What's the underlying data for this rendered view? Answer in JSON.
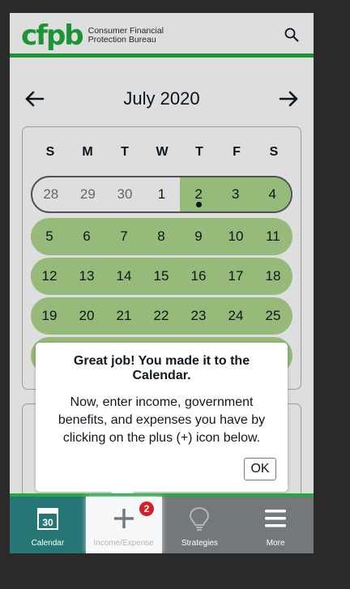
{
  "header": {
    "logo_mark": "cfpb",
    "logo_line1": "Consumer Financial",
    "logo_line2": "Protection Bureau",
    "search_icon": "search-icon"
  },
  "month_nav": {
    "title": "July 2020",
    "prev_icon": "arrow-left-icon",
    "next_icon": "arrow-right-icon"
  },
  "calendar": {
    "weekdays": [
      "S",
      "M",
      "T",
      "W",
      "T",
      "F",
      "S"
    ],
    "weeks": [
      [
        "28",
        "29",
        "30",
        "1",
        "2",
        "3",
        "4"
      ],
      [
        "5",
        "6",
        "7",
        "8",
        "9",
        "10",
        "11"
      ],
      [
        "12",
        "13",
        "14",
        "15",
        "16",
        "17",
        "18"
      ],
      [
        "19",
        "20",
        "21",
        "22",
        "23",
        "24",
        "25"
      ]
    ],
    "highlight_color": "#add68b"
  },
  "tooltip": {
    "title": "Great job! You made it to the Calendar.",
    "body": "Now, enter income, government benefits, and expenses you have by clicking on the plus (+) icon below.",
    "ok_label": "OK"
  },
  "bottom_nav": {
    "items": [
      {
        "label": "Calendar",
        "icon": "calendar-icon",
        "icon_text": "30"
      },
      {
        "label": "Income/Expense",
        "icon": "plus-icon"
      },
      {
        "label": "Strategies",
        "icon": "lightbulb-icon",
        "badge": "2"
      },
      {
        "label": "More",
        "icon": "menu-icon"
      }
    ]
  },
  "colors": {
    "brand_green": "#20aa3f",
    "active_teal": "#257675",
    "nav_gray": "#75787b",
    "badge_red": "#d12124"
  }
}
